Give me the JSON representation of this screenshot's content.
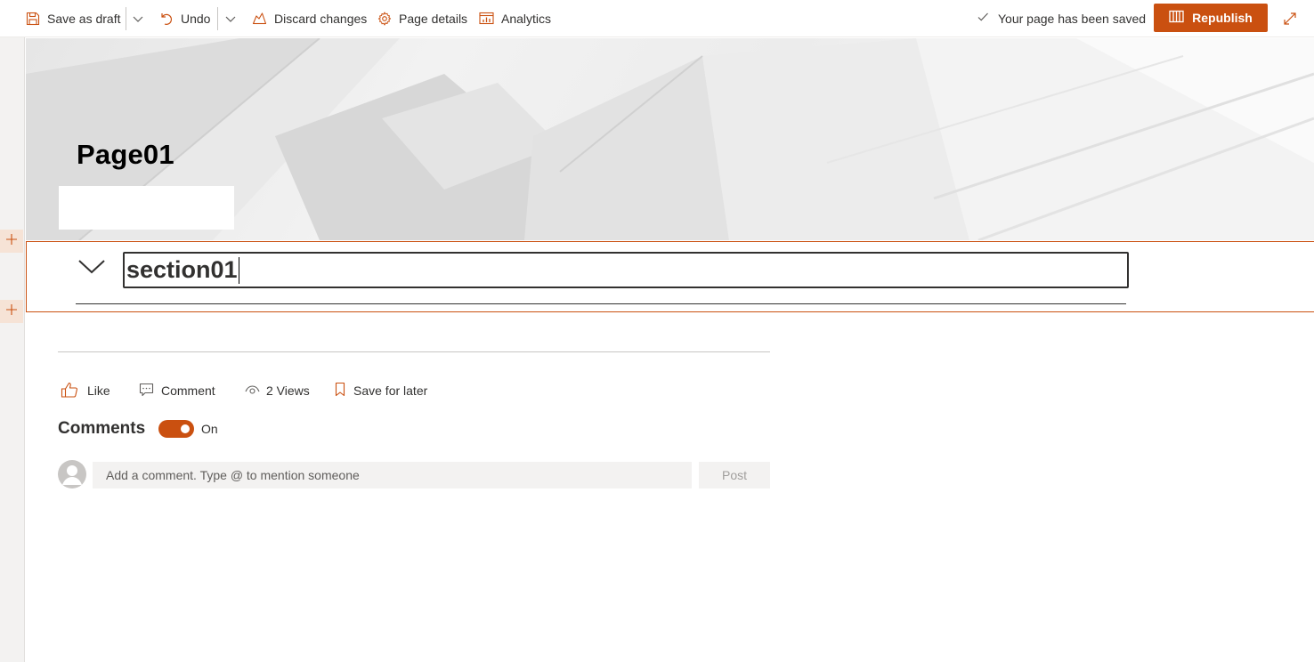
{
  "toolbar": {
    "save_draft_label": "Save as draft",
    "undo_label": "Undo",
    "discard_label": "Discard changes",
    "page_details_label": "Page details",
    "analytics_label": "Analytics",
    "status_text": "Your page has been saved",
    "republish_label": "Republish"
  },
  "page": {
    "title": "Page01"
  },
  "section": {
    "title": "section01"
  },
  "social": {
    "like_label": "Like",
    "comment_label": "Comment",
    "views_label": "2 Views",
    "save_later_label": "Save for later"
  },
  "comments": {
    "heading": "Comments",
    "toggle_state": "On",
    "placeholder": "Add a comment. Type @ to mention someone",
    "post_label": "Post"
  },
  "colors": {
    "accent": "#ca5010",
    "text": "#323130",
    "rail": "#f3f2f1"
  }
}
